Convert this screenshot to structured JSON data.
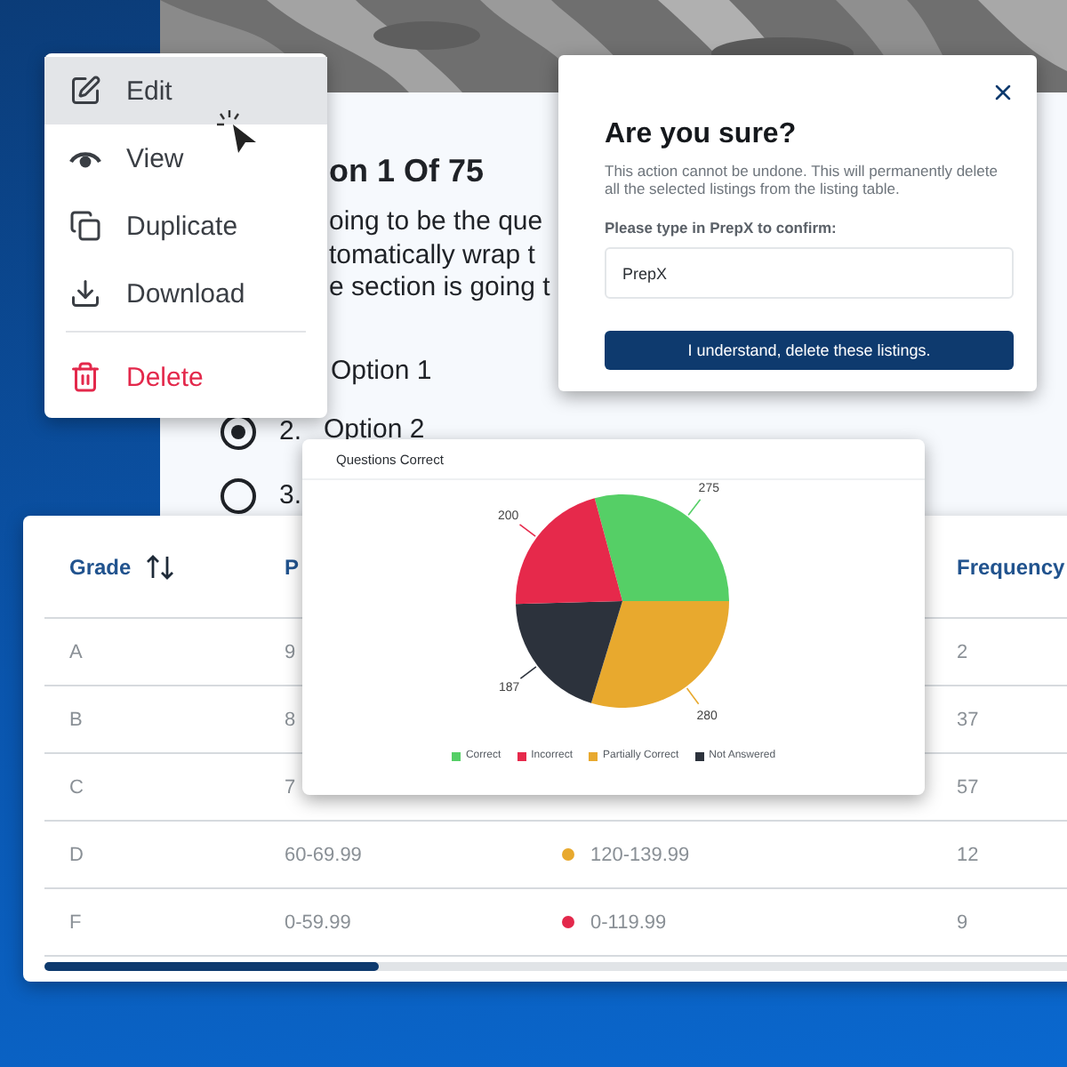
{
  "question_card": {
    "title": "on 1 Of 75",
    "text_lines": [
      "oing to be the que",
      "tomatically wrap t",
      "e section is going t"
    ],
    "partial_option": "Option 1",
    "options": [
      {
        "number": "2.",
        "label": "Option 2",
        "selected": true
      },
      {
        "number": "3.",
        "selected": false
      }
    ]
  },
  "context_menu": {
    "items": [
      {
        "kind": "edit",
        "label": "Edit",
        "highlighted": true
      },
      {
        "kind": "view",
        "label": "View",
        "highlighted": false
      },
      {
        "kind": "duplicate",
        "label": "Duplicate",
        "highlighted": false
      },
      {
        "kind": "download",
        "label": "Download",
        "highlighted": false
      },
      {
        "kind": "delete",
        "label": "Delete",
        "highlighted": false
      }
    ]
  },
  "dialog": {
    "title": "Are you sure?",
    "description": "This action cannot be undone. This will permanently delete all the selected listings from the listing table.",
    "field_label": "Please type in **PrepX** to confirm:",
    "field_value": "PrepX",
    "confirm_button": "I understand, delete these listings."
  },
  "table": {
    "header": {
      "grade": "Grade",
      "column_2": "P",
      "frequency": "Frequency"
    },
    "rows": [
      {
        "grade": "A",
        "column_2": "9",
        "frequency": "2"
      },
      {
        "grade": "B",
        "column_2": "8",
        "frequency": "37"
      },
      {
        "grade": "C",
        "column_2": "7",
        "frequency": "57"
      },
      {
        "grade": "D",
        "column_2": "60-69.99",
        "column_3": "120-139.99",
        "color": "#e8a92e",
        "frequency": "12"
      },
      {
        "grade": "F",
        "column_2": "0-59.99",
        "column_3": "0-119.99",
        "color": "#e3284b",
        "frequency": "9"
      }
    ]
  },
  "chart_card": {
    "chart_data": {
      "type": "pie",
      "title": "Questions Correct",
      "categories": [
        "Correct",
        "Incorrect",
        "Partially Correct",
        "Not Answered"
      ],
      "values": [
        275,
        200,
        280,
        187
      ],
      "colors": [
        "#55cf66",
        "#e6294b",
        "#e8a92e",
        "#2c323c"
      ],
      "data_labels": true
    }
  }
}
